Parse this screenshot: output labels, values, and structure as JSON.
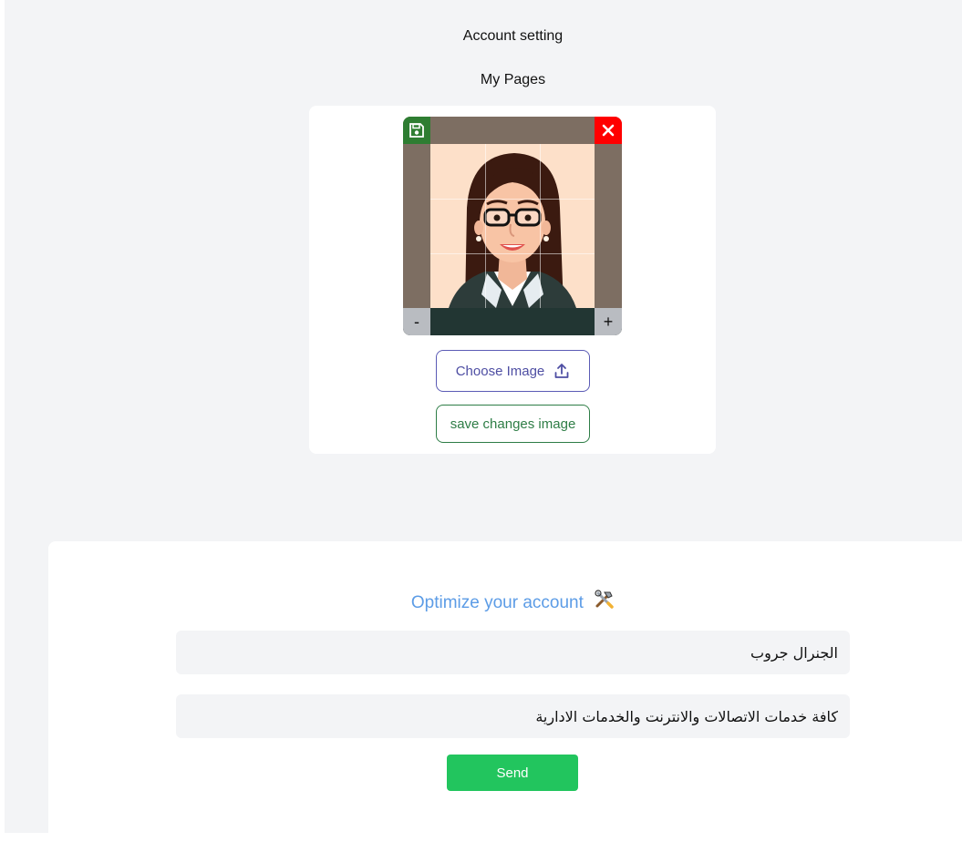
{
  "nav": {
    "account_setting": "Account setting",
    "my_pages": "My Pages"
  },
  "image_editor": {
    "zoom_out_label": "-",
    "zoom_in_label": "+",
    "choose_image_label": "Choose Image",
    "save_changes_label": "save changes image",
    "save_icon": "save-icon",
    "close_icon": "close-icon",
    "upload_icon": "upload-icon"
  },
  "form": {
    "title": "Optimize your account",
    "title_icon": "tools-icon",
    "name_value": "الجنرال جروب",
    "description_value": "كافة خدمات الاتصالات والانترنت والخدمات الادارية",
    "send_label": "Send"
  },
  "colors": {
    "page_bg": "#f3f4f6",
    "accent_blue": "#5c9ce6",
    "send_green": "#22c55e",
    "close_red": "#ff0000",
    "save_green": "#2e7d32",
    "choose_border": "#5b5bb5"
  }
}
